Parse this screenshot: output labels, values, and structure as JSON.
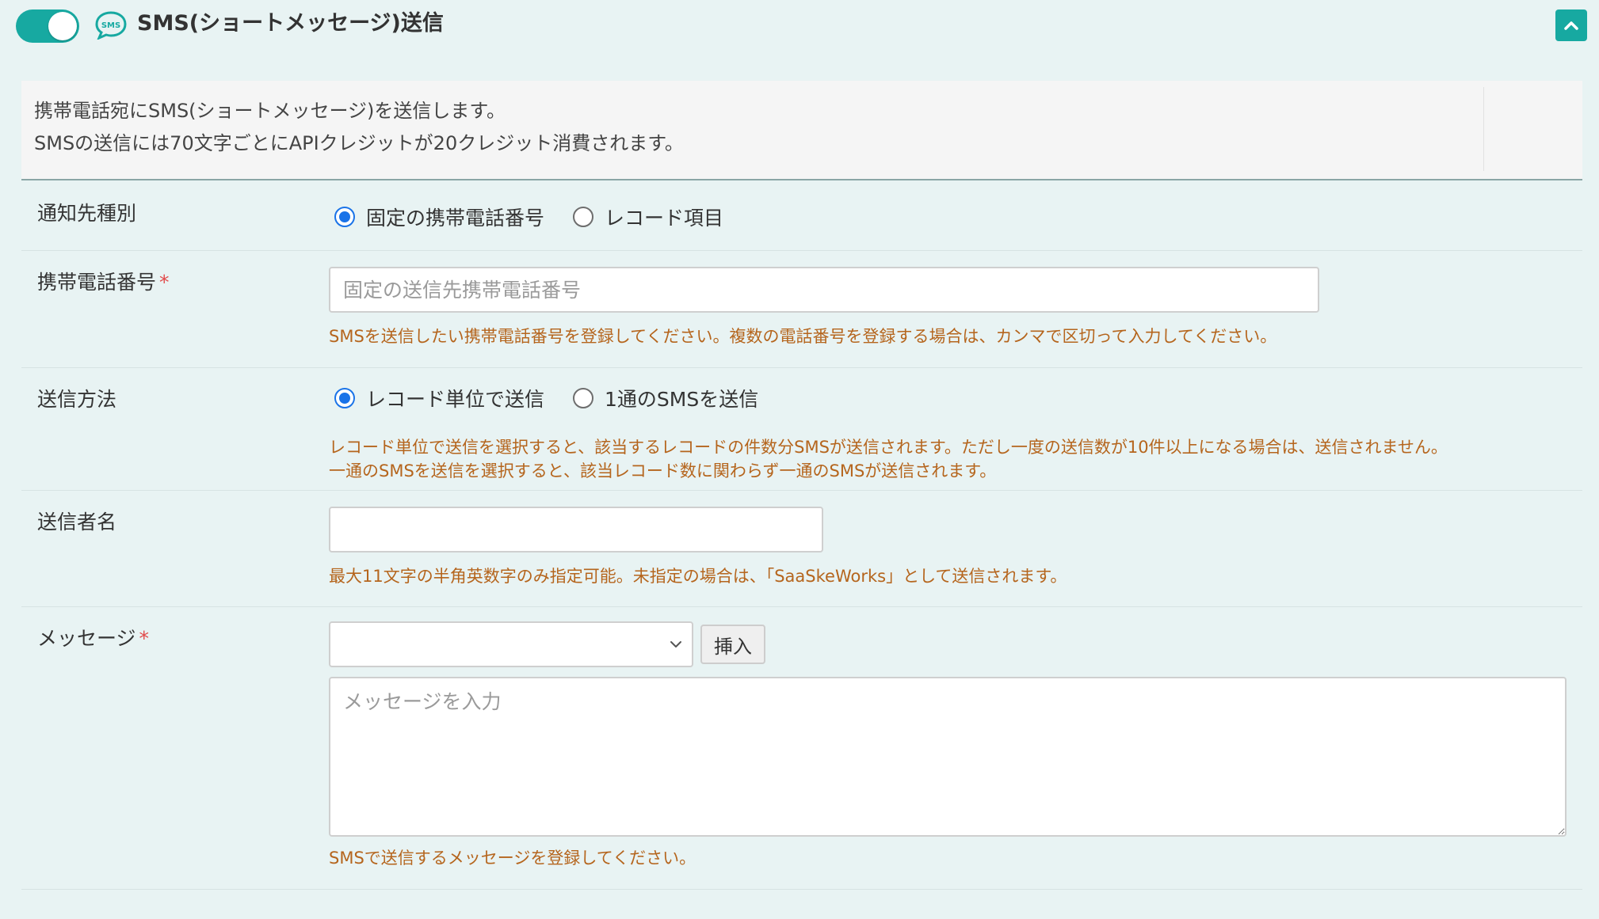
{
  "header": {
    "title": "SMS(ショートメッセージ)送信",
    "toggle_on": true,
    "accent_color": "#17a9a1"
  },
  "description": {
    "line1": "携帯電話宛にSMS(ショートメッセージ)を送信します。",
    "line2": "SMSの送信には70文字ごとにAPIクレジットが20クレジット消費されます。"
  },
  "fields": {
    "notify_type": {
      "label": "通知先種別",
      "options": [
        "固定の携帯電話番号",
        "レコード項目"
      ],
      "selected": "固定の携帯電話番号"
    },
    "phone": {
      "label": "携帯電話番号",
      "required_mark": "*",
      "placeholder": "固定の送信先携帯電話番号",
      "value": "",
      "help": "SMSを送信したい携帯電話番号を登録してください。複数の電話番号を登録する場合は、カンマで区切って入力してください。"
    },
    "send_method": {
      "label": "送信方法",
      "options": [
        "レコード単位で送信",
        "1通のSMSを送信"
      ],
      "selected": "レコード単位で送信",
      "help_line1": "レコード単位で送信を選択すると、該当するレコードの件数分SMSが送信されます。ただし一度の送信数が10件以上になる場合は、送信されません。",
      "help_line2": "一通のSMSを送信を選択すると、該当レコード数に関わらず一通のSMSが送信されます。"
    },
    "sender_name": {
      "label": "送信者名",
      "value": "",
      "help": "最大11文字の半角英数字のみ指定可能。未指定の場合は、「SaaSkeWorks」として送信されます。"
    },
    "message": {
      "label": "メッセージ",
      "required_mark": "*",
      "select_value": "",
      "insert_label": "挿入",
      "placeholder": "メッセージを入力",
      "value": "",
      "help": "SMSで送信するメッセージを登録してください。"
    }
  },
  "icons": {
    "sms": "sms-bubble-icon",
    "collapse": "chevron-up-icon",
    "select": "chevron-down-icon"
  },
  "colors": {
    "radio_selected": "#1a73e8",
    "help_text": "#b5651d",
    "required": "#e24b4b",
    "background": "#e8f3f3"
  }
}
